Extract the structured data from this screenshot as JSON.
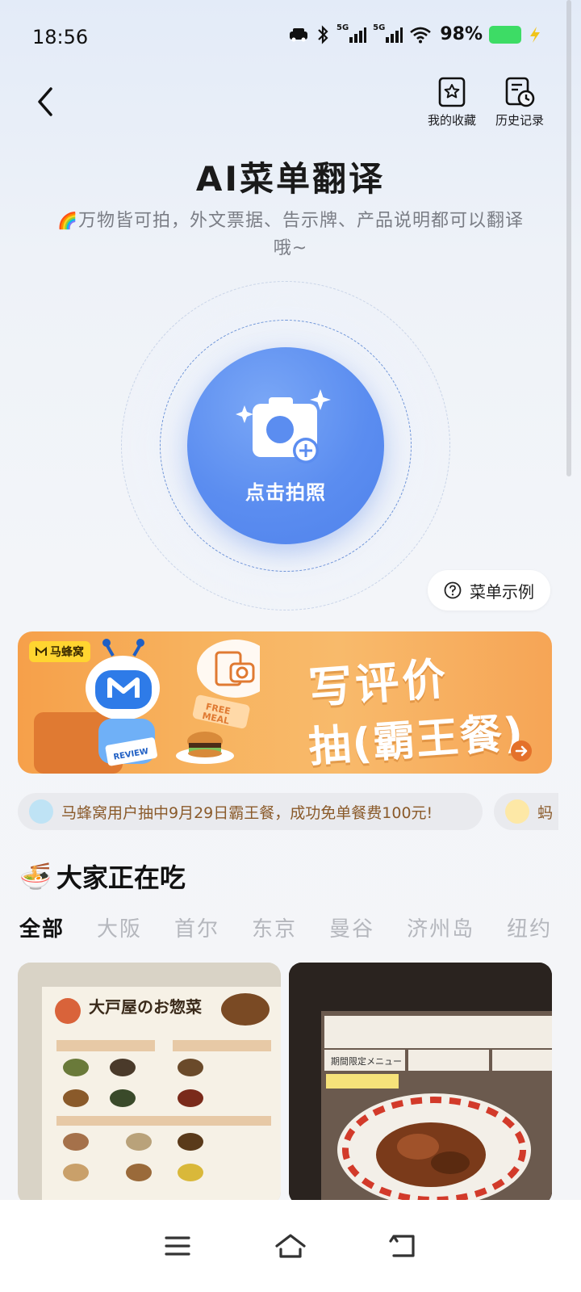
{
  "status_bar": {
    "time": "18:56",
    "battery": "98%",
    "sim1_label": "5G",
    "sim2_label": "5G",
    "icons": [
      "car-mode-icon",
      "bluetooth-icon",
      "signal-icon",
      "signal-icon",
      "wifi-icon",
      "battery-icon",
      "charging-icon"
    ]
  },
  "header": {
    "back_icon": "back-arrow-icon",
    "favorites_label": "我的收藏",
    "history_label": "历史记录"
  },
  "hero": {
    "title": "AI菜单翻译",
    "subtitle_emoji": "🌈",
    "subtitle": "万物皆可拍，外文票据、告示牌、产品说明都可以翻译哦~",
    "shoot_label": "点击拍照",
    "example_label": "菜单示例"
  },
  "banner": {
    "brand": "马蜂窝",
    "headline": "写评价",
    "subline": "抽(霸王餐)",
    "badge_text": "FREE MEAL",
    "review_text": "REVIEW"
  },
  "ticker": {
    "message": "马蜂窝用户抽中9月29日霸王餐，成功免单餐费100元!",
    "message2": "蚂"
  },
  "section": {
    "emoji": "🍜",
    "title": "大家正在吃",
    "tabs": [
      "全部",
      "大阪",
      "首尔",
      "东京",
      "曼谷",
      "济州岛",
      "纽约"
    ]
  },
  "cards": [
    {
      "caption": "大戸屋のお惣菜"
    },
    {
      "caption": "期間限定メニュー"
    }
  ],
  "colors": {
    "accent": "#5b8df0",
    "banner": "#f7b35f",
    "ticker_text": "#8a5a2a",
    "battery": "#3ddc65"
  }
}
